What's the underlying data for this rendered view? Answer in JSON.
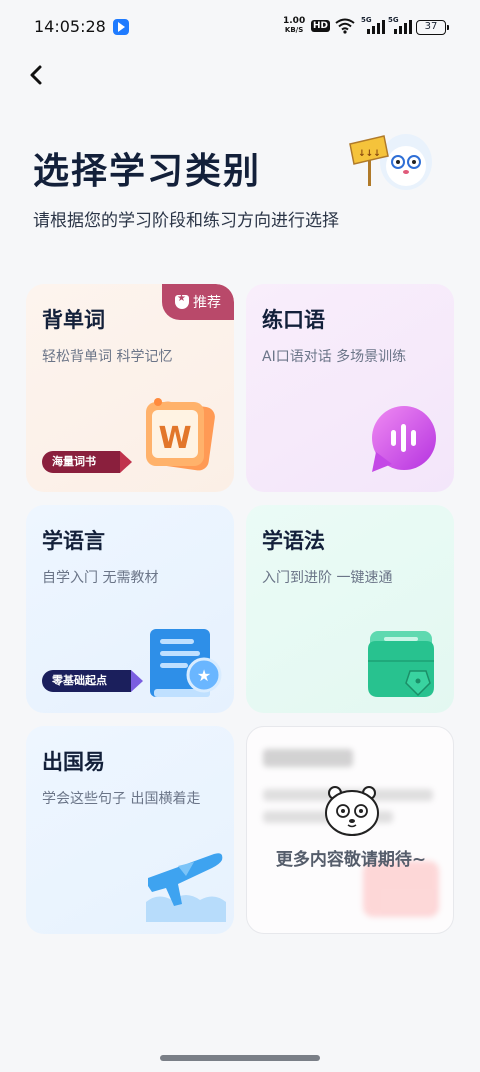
{
  "status_bar": {
    "time": "14:05:28",
    "speed_value": "1.00",
    "speed_unit": "KB/S",
    "hd_label": "HD",
    "signal1_label": "5G",
    "signal2_label": "5G",
    "battery": "37"
  },
  "header": {
    "title": "选择学习类别",
    "subtitle": "请根据您的学习阶段和练习方向进行选择"
  },
  "cards": {
    "vocab": {
      "title": "背单词",
      "desc": "轻松背单词 科学记忆",
      "badge": "推荐",
      "ribbon": "海量词书",
      "art_letter": "W"
    },
    "speaking": {
      "title": "练口语",
      "desc": "AI口语对话 多场景训练"
    },
    "language": {
      "title": "学语言",
      "desc": "自学入门 无需教材",
      "ribbon": "零基础起点"
    },
    "grammar": {
      "title": "学语法",
      "desc": "入门到进阶 一键速通"
    },
    "abroad": {
      "title": "出国易",
      "desc": "学会这些句子 出国横着走"
    },
    "more": {
      "text": "更多内容敬请期待~"
    }
  },
  "colors": {
    "badge": "#b9496a",
    "ribbon_red": "#8a1f3d",
    "ribbon_navy": "#1b1f5c",
    "title_text": "#13203a"
  },
  "icons": {
    "back": "back-chevron-icon",
    "mascot": "mascot-with-sign-icon",
    "vocab_art": "w-book-icon",
    "speaking_art": "voice-bubble-icon",
    "language_art": "textbook-badge-icon",
    "grammar_art": "green-folder-pen-icon",
    "abroad_art": "airplane-icon",
    "more_art": "bear-face-icon"
  }
}
